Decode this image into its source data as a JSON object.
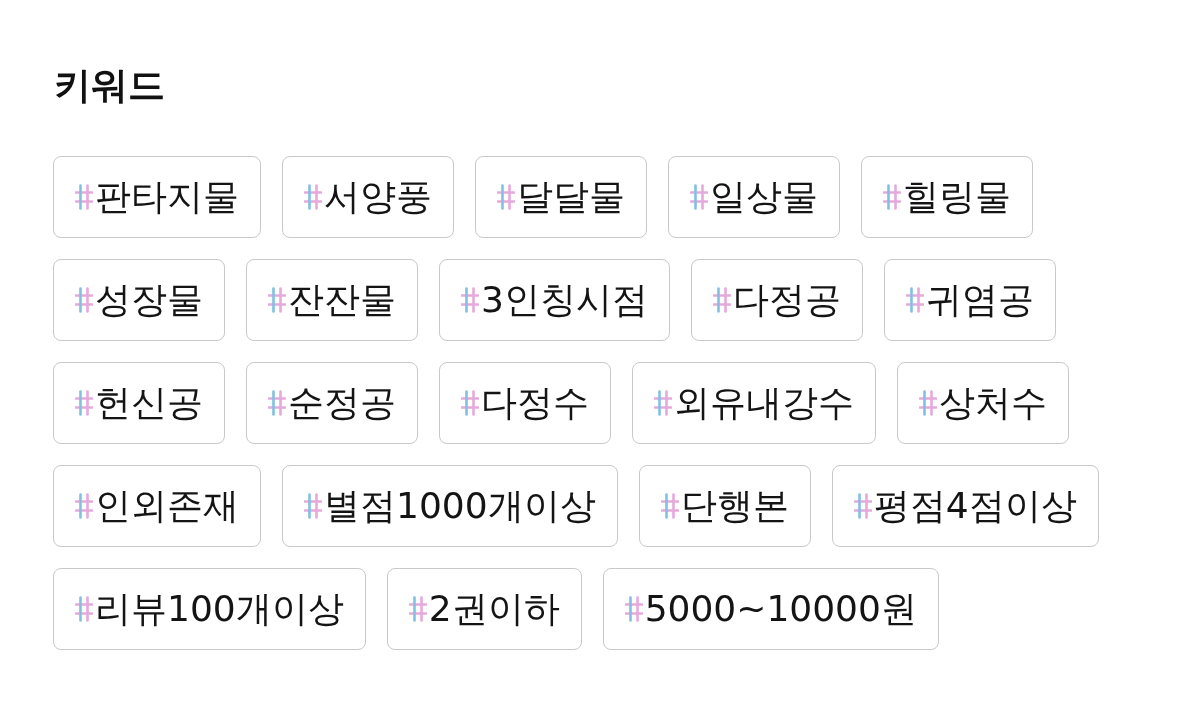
{
  "title": "키워드",
  "keywords": [
    {
      "label": "판타지물"
    },
    {
      "label": "서양풍"
    },
    {
      "label": "달달물"
    },
    {
      "label": "일상물"
    },
    {
      "label": "힐링물"
    },
    {
      "label": "성장물"
    },
    {
      "label": "잔잔물"
    },
    {
      "label": "3인칭시점"
    },
    {
      "label": "다정공"
    },
    {
      "label": "귀염공"
    },
    {
      "label": "헌신공"
    },
    {
      "label": "순정공"
    },
    {
      "label": "다정수"
    },
    {
      "label": "외유내강수"
    },
    {
      "label": "상처수"
    },
    {
      "label": "인외존재"
    },
    {
      "label": "별점1000개이상"
    },
    {
      "label": "단행본"
    },
    {
      "label": "평점4점이상"
    },
    {
      "label": "리뷰100개이상"
    },
    {
      "label": "2권이하"
    },
    {
      "label": "5000~10000원"
    }
  ]
}
